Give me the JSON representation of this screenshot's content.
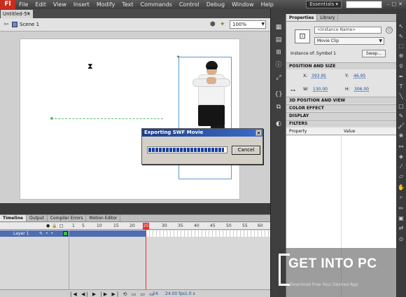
{
  "menubar": {
    "logo": "Fl",
    "items": [
      "File",
      "Edit",
      "View",
      "Insert",
      "Modify",
      "Text",
      "Commands",
      "Control",
      "Debug",
      "Window",
      "Help"
    ],
    "workspace": "Essentials ▾"
  },
  "document": {
    "tab_title": "Untitled-5*",
    "scene_label": "Scene 1",
    "zoom": "100%"
  },
  "dialog": {
    "title": "Exporting SWF Movie",
    "cancel_label": "Cancel",
    "progress_fraction": 0.97
  },
  "timeline": {
    "tabs": [
      "Timeline",
      "Output",
      "Compiler Errors",
      "Motion Editor"
    ],
    "frame_numbers": [
      "1",
      "5",
      "10",
      "15",
      "20",
      "25",
      "30",
      "35",
      "40",
      "45",
      "50",
      "55",
      "60"
    ],
    "current_frame": "25",
    "layer_name": "Layer 1",
    "status": {
      "frame": "24",
      "fps": "24.00 fps",
      "time": "1.0 s"
    }
  },
  "properties": {
    "tabs": [
      "Properties",
      "Library"
    ],
    "instance_name_placeholder": "<Instance Name>",
    "symbol_type": "Movie Clip",
    "instance_of": "Instance of:  Symbol 1",
    "swap_label": "Swap...",
    "sections": {
      "position_size": "POSITION AND SIZE",
      "position_3d": "3D POSITION AND VIEW",
      "color_effect": "COLOR EFFECT",
      "display": "DISPLAY",
      "filters": "FILTERS"
    },
    "x_label": "X:",
    "x_value": "393.95",
    "y_label": "Y:",
    "y_value": "46.95",
    "w_label": "W:",
    "w_value": "130.00",
    "h_label": "H:",
    "h_value": "306.00",
    "filters_columns": [
      "Property",
      "Value"
    ]
  },
  "watermark": {
    "title": "GET INTO PC",
    "subtitle": "Download Free Your Desired App"
  }
}
